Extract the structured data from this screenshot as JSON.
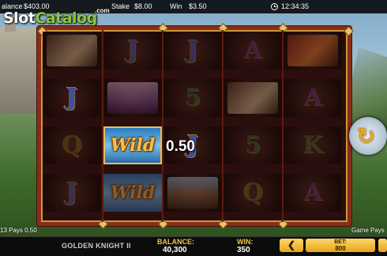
{
  "topbar": {
    "balance_label": "alance",
    "balance_value": "$403.00",
    "stake_label": "Stake",
    "stake_value": "$8.00",
    "win_label": "Win",
    "win_value": "$3.50",
    "time": "12:34:35",
    "clock_icon": "clock-icon"
  },
  "watermark": {
    "part1": "Slot",
    "part2": "Catalog",
    "suffix": ".com"
  },
  "reels": [
    [
      "horse",
      "J",
      "Q",
      "J"
    ],
    [
      "J",
      "lady",
      "Wild",
      "Wild"
    ],
    [
      "J",
      "5",
      "J",
      "knight"
    ],
    [
      "A",
      "horse",
      "5",
      "Q"
    ],
    [
      "dragon",
      "A",
      "K",
      "A"
    ]
  ],
  "win_amount": "0.50",
  "side_left": "13 Pays 0.50",
  "side_right": "Game Pays",
  "bottom": {
    "game_name": "GOLDEN KNIGHT II",
    "balance_label": "BALANCE:",
    "balance_value": "40,300",
    "win_label": "WIN:",
    "win_value": "350",
    "arrow": "❮",
    "bet_label": "BET:",
    "bet_value": "800"
  },
  "colors": {
    "frame": "#8a2c1a",
    "gold": "#f2c24a",
    "accent_green": "#8ec63f"
  }
}
